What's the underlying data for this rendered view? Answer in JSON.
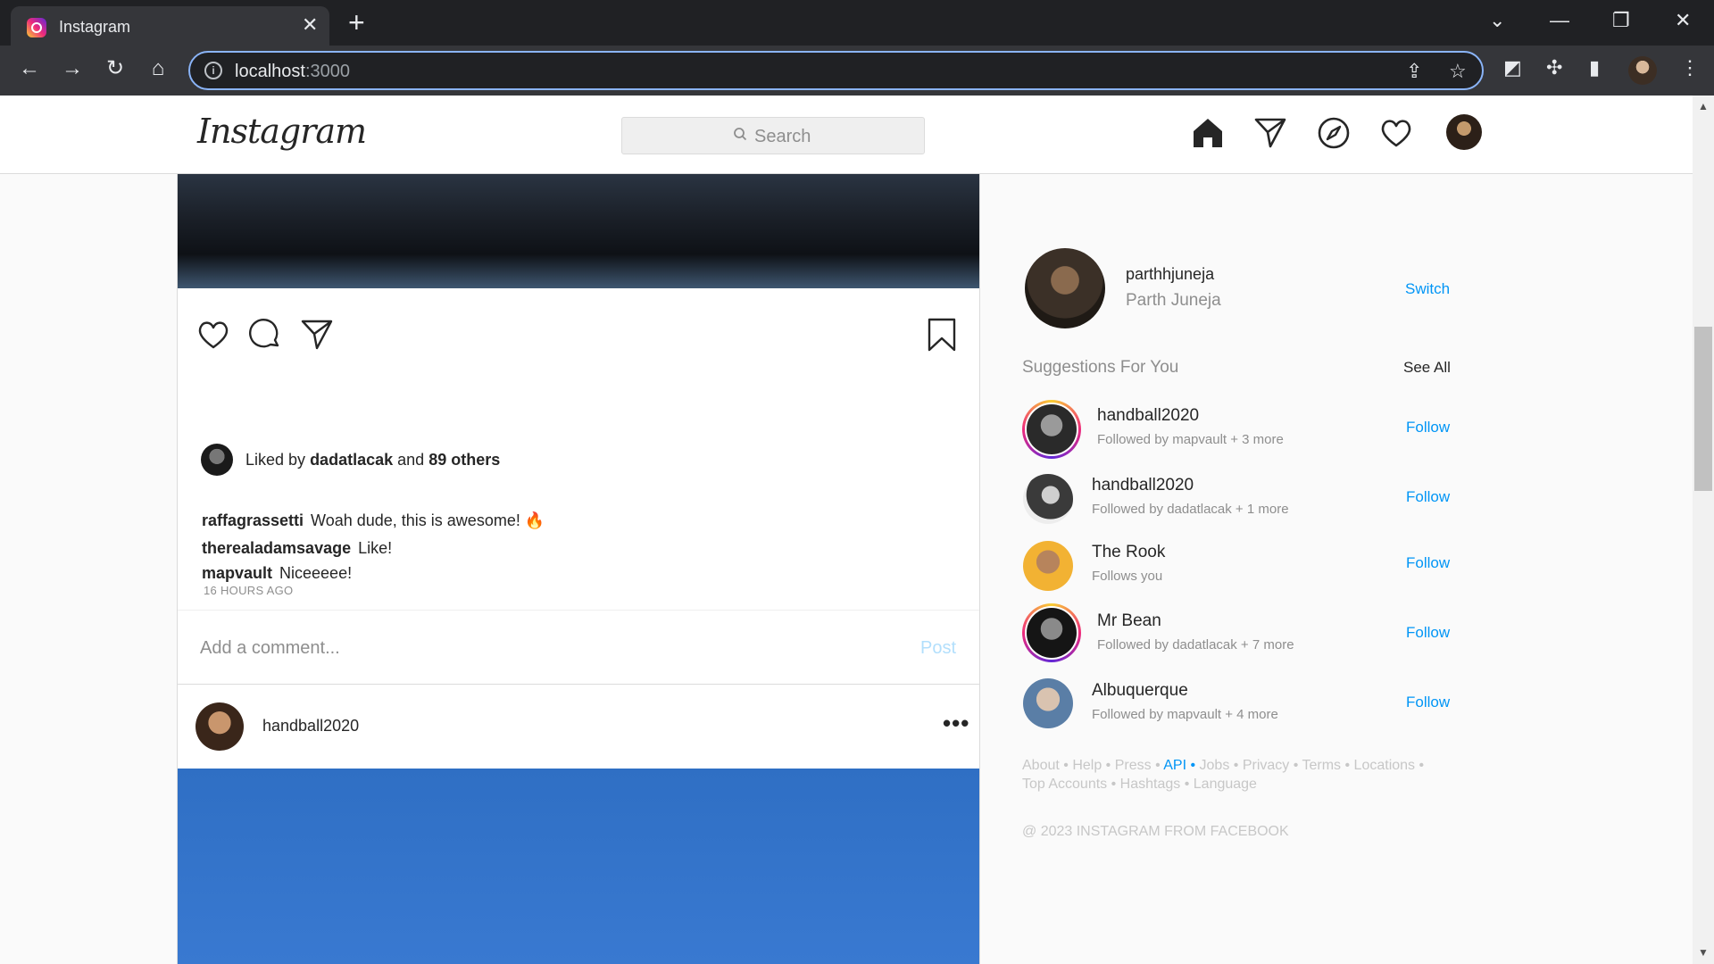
{
  "browser": {
    "tab_title": "Instagram",
    "url_host": "localhost",
    "url_port": ":3000"
  },
  "header": {
    "logo": "Instagram",
    "search_placeholder": "Search"
  },
  "post1": {
    "liked_prefix": "Liked by",
    "liked_user": "dadatlacak",
    "liked_and": "and",
    "liked_others": "89 others",
    "comments": [
      {
        "user": "raffagrassetti",
        "text": "Woah dude, this is awesome! 🔥"
      },
      {
        "user": "therealadamsavage",
        "text": "Like!"
      },
      {
        "user": "mapvault",
        "text": "Niceeeee!"
      }
    ],
    "time": "16 HOURS AGO",
    "comment_placeholder": "Add a comment...",
    "post_label": "Post"
  },
  "post2": {
    "username": "handball2020",
    "more": "•••"
  },
  "sidebar": {
    "me": {
      "username": "parthhjuneja",
      "fullname": "Parth Juneja",
      "switch_label": "Switch"
    },
    "suggestions_title": "Suggestions For You",
    "see_all": "See All",
    "suggestions": [
      {
        "name": "handball2020",
        "sub": "Followed by mapvault + 3 more",
        "follow": "Follow",
        "has_story": true
      },
      {
        "name": "handball2020",
        "sub": "Followed by dadatlacak + 1 more",
        "follow": "Follow",
        "has_story": false
      },
      {
        "name": "The Rook",
        "sub": "Follows you",
        "follow": "Follow",
        "has_story": false
      },
      {
        "name": "Mr Bean",
        "sub": "Followed by dadatlacak + 7 more",
        "follow": "Follow",
        "has_story": true
      },
      {
        "name": "Albuquerque",
        "sub": "Followed by mapvault + 4 more",
        "follow": "Follow",
        "has_story": false
      }
    ],
    "footer_links": [
      "About",
      "Help",
      "Press",
      "API",
      "Jobs",
      "Privacy",
      "Terms",
      "Locations",
      "Top Accounts",
      "Hashtags",
      "Language"
    ],
    "copyright": "@ 2023 INSTAGRAM FROM FACEBOOK"
  },
  "colors": {
    "accent": "#0095f6",
    "post_disabled": "#b2dffc",
    "muted": "#8e8e8e"
  }
}
